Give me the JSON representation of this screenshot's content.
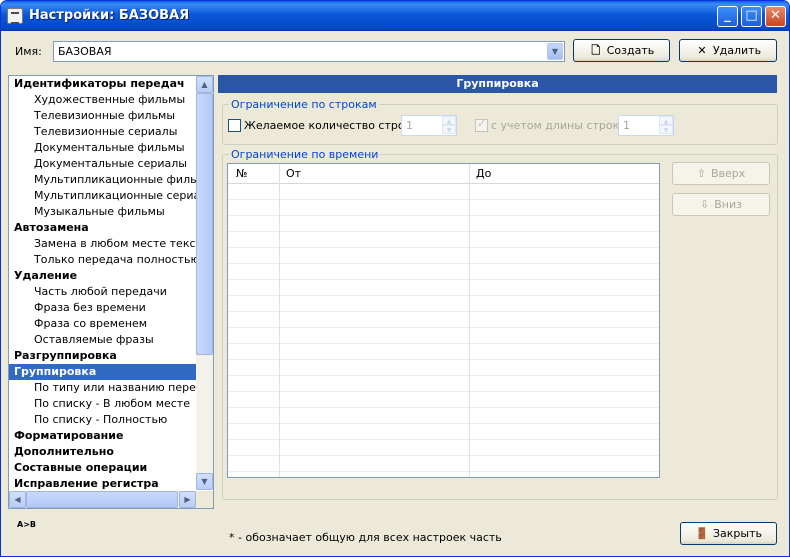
{
  "window": {
    "title": "Настройки: БАЗОВАЯ",
    "controls": {
      "minimize": "_",
      "maximize": "□",
      "close": "✕"
    }
  },
  "profile": {
    "label": "Имя:",
    "value": "БАЗОВАЯ",
    "create_label": "Создать",
    "delete_label": "Удалить"
  },
  "tree": {
    "items": [
      {
        "label": "Идентификаторы передач",
        "level": 0
      },
      {
        "label": "Художественные фильмы",
        "level": 1
      },
      {
        "label": "Телевизионные фильмы",
        "level": 1
      },
      {
        "label": "Телевизионные сериалы",
        "level": 1
      },
      {
        "label": "Документальные фильмы",
        "level": 1
      },
      {
        "label": "Документальные сериалы",
        "level": 1
      },
      {
        "label": "Мультипликационные фильмы",
        "level": 1
      },
      {
        "label": "Мультипликационные сериалы",
        "level": 1
      },
      {
        "label": "Музыкальные фильмы",
        "level": 1
      },
      {
        "label": "Автозамена",
        "level": 0
      },
      {
        "label": "Замена в любом месте текста",
        "level": 1
      },
      {
        "label": "Только передача полностью",
        "level": 1
      },
      {
        "label": "Удаление",
        "level": 0
      },
      {
        "label": "Часть любой передачи",
        "level": 1
      },
      {
        "label": "Фраза без времени",
        "level": 1
      },
      {
        "label": "Фраза со временем",
        "level": 1
      },
      {
        "label": "Оставляемые фразы",
        "level": 1
      },
      {
        "label": "Разгруппировка",
        "level": 0
      },
      {
        "label": "Группировка",
        "level": 0,
        "selected": true
      },
      {
        "label": "По типу или названию передачи",
        "level": 1
      },
      {
        "label": "По списку - В любом месте",
        "level": 1
      },
      {
        "label": "По списку - Полностью",
        "level": 1
      },
      {
        "label": "Форматирование",
        "level": 0
      },
      {
        "label": "Дополнительно",
        "level": 0
      },
      {
        "label": "Составные операции",
        "level": 0
      },
      {
        "label": "Исправление регистра",
        "level": 0
      }
    ]
  },
  "panel": {
    "title": "Группировка",
    "rows_group": {
      "title": "Ограничение по строкам",
      "desired_count_label": "Желаемое количество строк",
      "desired_count_value": "1",
      "line_length_label": "с учетом длины строки",
      "line_length_value": "1"
    },
    "time_group": {
      "title": "Ограничение по времени",
      "columns": [
        "№",
        "От",
        "До"
      ],
      "up_label": "Вверх",
      "down_label": "Вниз"
    }
  },
  "footer": {
    "note": "* - обозначает общую для всех настроек часть",
    "close_label": "Закрыть",
    "icon_text": "A>B"
  },
  "colors": {
    "titlebar": "#0a58d8",
    "panel_header": "#2a57a5",
    "selection": "#316ac5",
    "group_title": "#0046d5"
  }
}
